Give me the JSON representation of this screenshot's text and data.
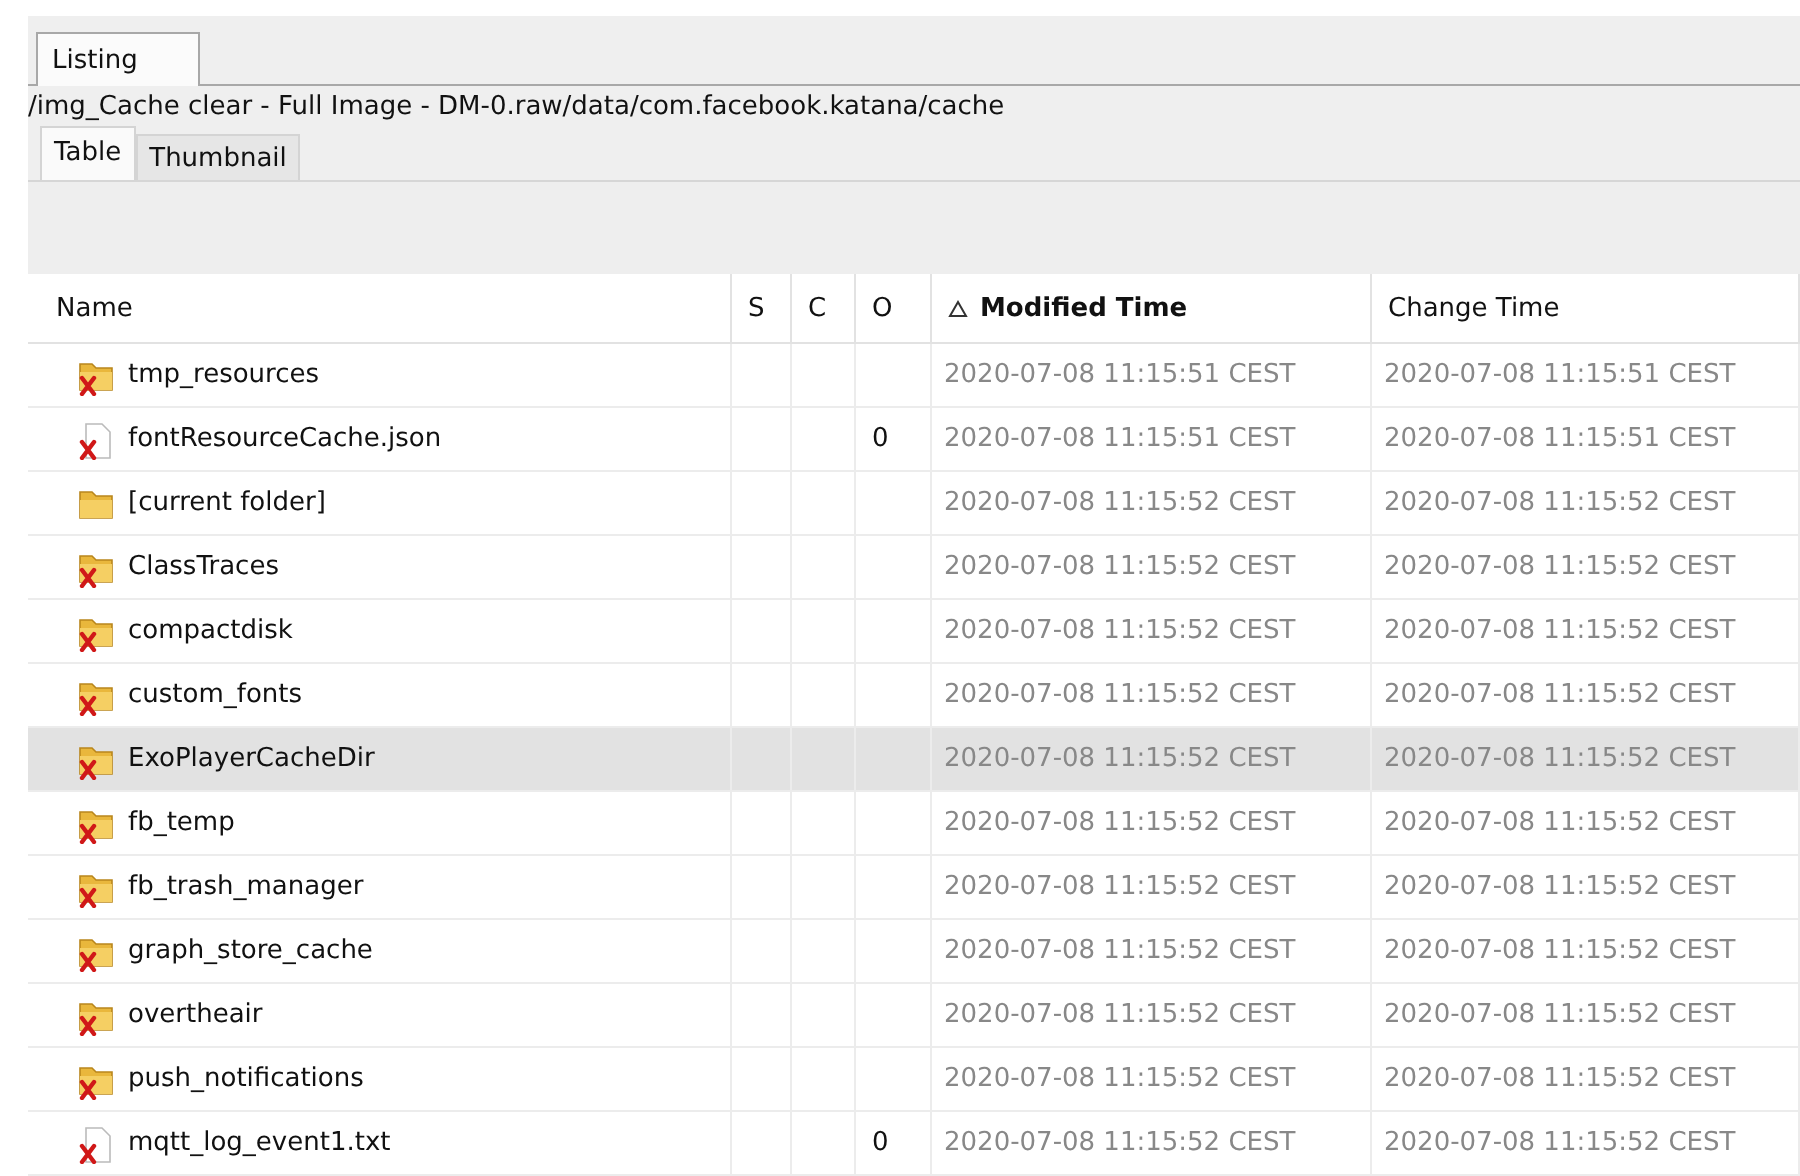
{
  "panel_tab": {
    "label": "Listing",
    "selected": true
  },
  "path": "/img_Cache clear - Full Image - DM-0.raw/data/com.facebook.katana/cache",
  "view_tabs": [
    {
      "label": "Table",
      "selected": true
    },
    {
      "label": "Thumbnail",
      "selected": false
    }
  ],
  "table": {
    "columns": [
      {
        "label": "Name",
        "sorted": false
      },
      {
        "label": "S",
        "sorted": false
      },
      {
        "label": "C",
        "sorted": false
      },
      {
        "label": "O",
        "sorted": false
      },
      {
        "label": "Modified Time",
        "sorted": true
      },
      {
        "label": "Change Time",
        "sorted": false
      }
    ],
    "rows": [
      {
        "kind": "deleted-folder",
        "name": "tmp_resources",
        "o": "",
        "modified": "2020-07-08 11:15:51 CEST",
        "changed": "2020-07-08 11:15:51 CEST",
        "selected": false
      },
      {
        "kind": "deleted-file",
        "name": "fontResourceCache.json",
        "o": "0",
        "modified": "2020-07-08 11:15:51 CEST",
        "changed": "2020-07-08 11:15:51 CEST",
        "selected": false
      },
      {
        "kind": "folder",
        "name": "[current folder]",
        "o": "",
        "modified": "2020-07-08 11:15:52 CEST",
        "changed": "2020-07-08 11:15:52 CEST",
        "selected": false
      },
      {
        "kind": "deleted-folder",
        "name": "ClassTraces",
        "o": "",
        "modified": "2020-07-08 11:15:52 CEST",
        "changed": "2020-07-08 11:15:52 CEST",
        "selected": false
      },
      {
        "kind": "deleted-folder",
        "name": "compactdisk",
        "o": "",
        "modified": "2020-07-08 11:15:52 CEST",
        "changed": "2020-07-08 11:15:52 CEST",
        "selected": false
      },
      {
        "kind": "deleted-folder",
        "name": "custom_fonts",
        "o": "",
        "modified": "2020-07-08 11:15:52 CEST",
        "changed": "2020-07-08 11:15:52 CEST",
        "selected": false
      },
      {
        "kind": "deleted-folder",
        "name": "ExoPlayerCacheDir",
        "o": "",
        "modified": "2020-07-08 11:15:52 CEST",
        "changed": "2020-07-08 11:15:52 CEST",
        "selected": true
      },
      {
        "kind": "deleted-folder",
        "name": "fb_temp",
        "o": "",
        "modified": "2020-07-08 11:15:52 CEST",
        "changed": "2020-07-08 11:15:52 CEST",
        "selected": false
      },
      {
        "kind": "deleted-folder",
        "name": "fb_trash_manager",
        "o": "",
        "modified": "2020-07-08 11:15:52 CEST",
        "changed": "2020-07-08 11:15:52 CEST",
        "selected": false
      },
      {
        "kind": "deleted-folder",
        "name": "graph_store_cache",
        "o": "",
        "modified": "2020-07-08 11:15:52 CEST",
        "changed": "2020-07-08 11:15:52 CEST",
        "selected": false
      },
      {
        "kind": "deleted-folder",
        "name": "overtheair",
        "o": "",
        "modified": "2020-07-08 11:15:52 CEST",
        "changed": "2020-07-08 11:15:52 CEST",
        "selected": false
      },
      {
        "kind": "deleted-folder",
        "name": "push_notifications",
        "o": "",
        "modified": "2020-07-08 11:15:52 CEST",
        "changed": "2020-07-08 11:15:52 CEST",
        "selected": false
      },
      {
        "kind": "deleted-file",
        "name": "mqtt_log_event1.txt",
        "o": "0",
        "modified": "2020-07-08 11:15:52 CEST",
        "changed": "2020-07-08 11:15:52 CEST",
        "selected": false
      }
    ]
  }
}
